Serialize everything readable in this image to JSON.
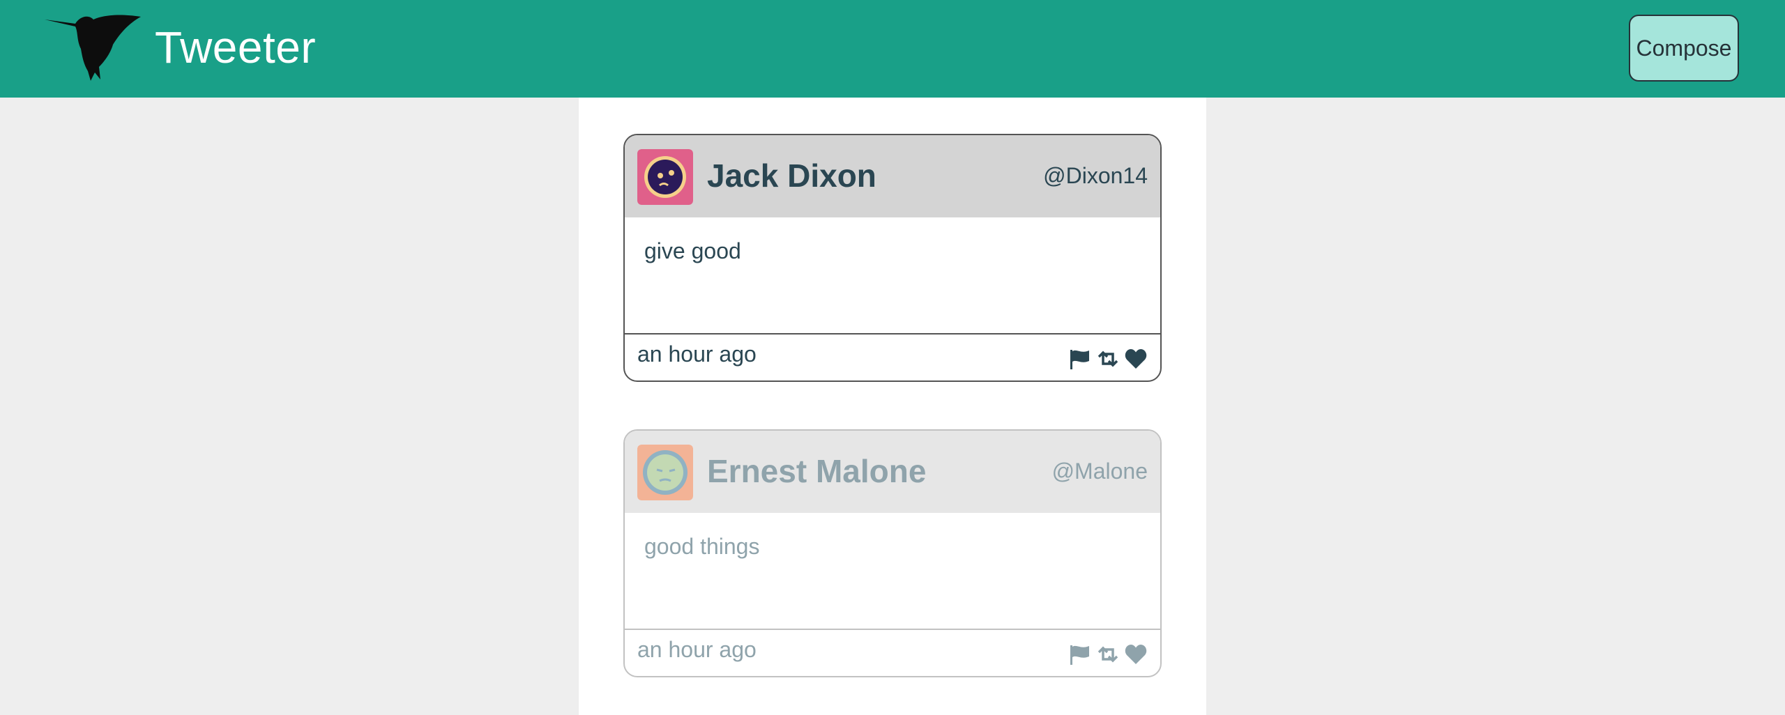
{
  "app": {
    "title": "Tweeter",
    "compose_label": "Compose",
    "brand_color": "#19a088"
  },
  "tweets": [
    {
      "name": "Jack Dixon",
      "handle": "@Dixon14",
      "content": "give good",
      "timestamp": "an hour ago",
      "avatar_colors": {
        "bg": "#e0608a",
        "ring": "#f5d08a",
        "face": "#2b1a5a"
      },
      "icons": [
        "flag-icon",
        "retweet-icon",
        "heart-icon"
      ]
    },
    {
      "name": "Ernest Malone",
      "handle": "@Malone",
      "content": "good things",
      "timestamp": "an hour ago",
      "avatar_colors": {
        "bg": "#ff8a55",
        "ring": "#4a88a8",
        "face": "#a8d08a"
      },
      "icons": [
        "flag-icon",
        "retweet-icon",
        "heart-icon"
      ]
    }
  ]
}
